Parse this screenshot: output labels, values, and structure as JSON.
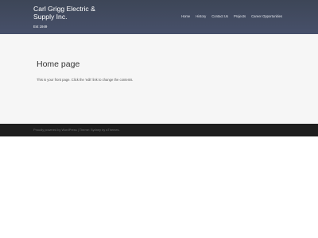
{
  "header": {
    "site_title_line1": "Carl Grigg Electric &",
    "site_title_line2": "Supply Inc.",
    "tagline": "Est 1949",
    "nav": [
      "Home",
      "History",
      "Contact Us",
      "Projects",
      "Career Opportunities"
    ]
  },
  "main": {
    "page_title": "Home page",
    "body_text": "This is your front page. Click the 'edit' link to change the contents."
  },
  "footer": {
    "powered_by": "Proudly powered by WordPress",
    "separator": " | ",
    "theme_credit": "Theme: Sydney by aThemes."
  },
  "colors": {
    "header_bg": "#434c61",
    "content_bg": "#f6f6f6",
    "footer_bg": "#1e1e1e"
  }
}
